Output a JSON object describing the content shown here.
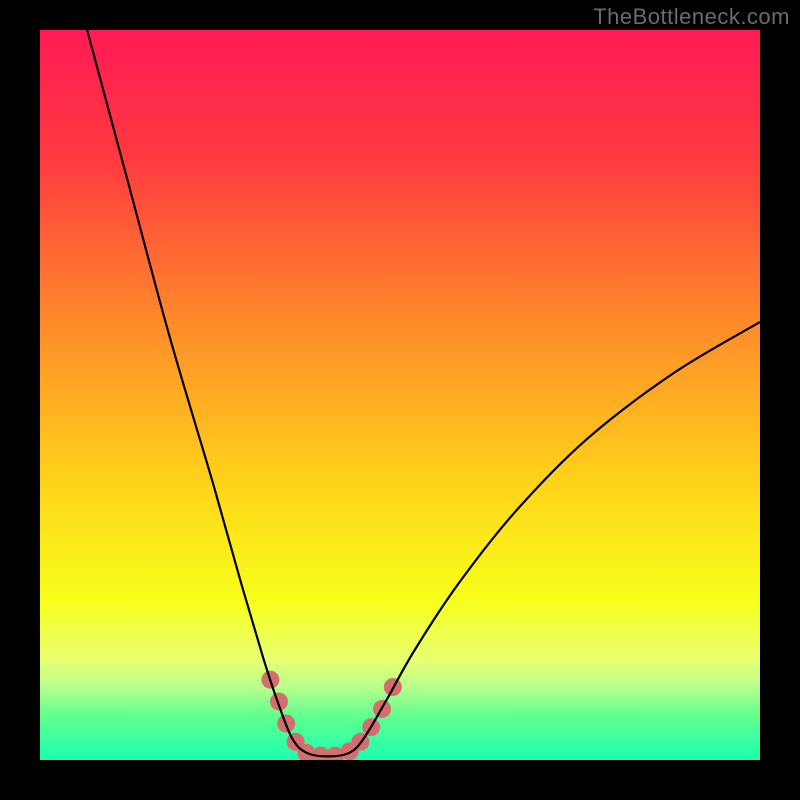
{
  "watermark": "TheBottleneck.com",
  "chart_data": {
    "type": "line",
    "title": "",
    "xlabel": "",
    "ylabel": "",
    "xlim": [
      0,
      100
    ],
    "ylim": [
      0,
      100
    ],
    "background_gradient_stops": [
      {
        "offset": 0.0,
        "color": "#ff1a55"
      },
      {
        "offset": 0.18,
        "color": "#ff3b3f"
      },
      {
        "offset": 0.4,
        "color": "#ff8a2a"
      },
      {
        "offset": 0.62,
        "color": "#ffd31a"
      },
      {
        "offset": 0.78,
        "color": "#f7ff1a"
      },
      {
        "offset": 0.86,
        "color": "#e9ff6e"
      },
      {
        "offset": 0.9,
        "color": "#b8ff8c"
      },
      {
        "offset": 0.94,
        "color": "#5eff8e"
      },
      {
        "offset": 1.0,
        "color": "#1cffb1"
      }
    ],
    "series": [
      {
        "name": "bottleneck-curve",
        "stroke": "#000000",
        "points": [
          {
            "x": 6,
            "y": 102
          },
          {
            "x": 12,
            "y": 80
          },
          {
            "x": 18,
            "y": 58
          },
          {
            "x": 24,
            "y": 38
          },
          {
            "x": 28,
            "y": 24
          },
          {
            "x": 31,
            "y": 14
          },
          {
            "x": 33,
            "y": 8
          },
          {
            "x": 35,
            "y": 3
          },
          {
            "x": 37,
            "y": 1
          },
          {
            "x": 40,
            "y": 0.5
          },
          {
            "x": 43,
            "y": 1
          },
          {
            "x": 45,
            "y": 3
          },
          {
            "x": 48,
            "y": 8
          },
          {
            "x": 52,
            "y": 15
          },
          {
            "x": 58,
            "y": 24
          },
          {
            "x": 66,
            "y": 34
          },
          {
            "x": 76,
            "y": 44
          },
          {
            "x": 88,
            "y": 53
          },
          {
            "x": 100,
            "y": 60
          }
        ]
      }
    ],
    "highlight_blobs": {
      "color": "#d46d6d",
      "radius_px": 9,
      "points": [
        {
          "x": 32.0,
          "y": 11.0
        },
        {
          "x": 33.2,
          "y": 8.0
        },
        {
          "x": 34.2,
          "y": 5.0
        },
        {
          "x": 35.5,
          "y": 2.5
        },
        {
          "x": 37.0,
          "y": 1.0
        },
        {
          "x": 39.0,
          "y": 0.6
        },
        {
          "x": 41.0,
          "y": 0.6
        },
        {
          "x": 43.0,
          "y": 1.2
        },
        {
          "x": 44.5,
          "y": 2.5
        },
        {
          "x": 46.0,
          "y": 4.5
        },
        {
          "x": 47.5,
          "y": 7.0
        },
        {
          "x": 49.0,
          "y": 10.0
        }
      ]
    }
  }
}
